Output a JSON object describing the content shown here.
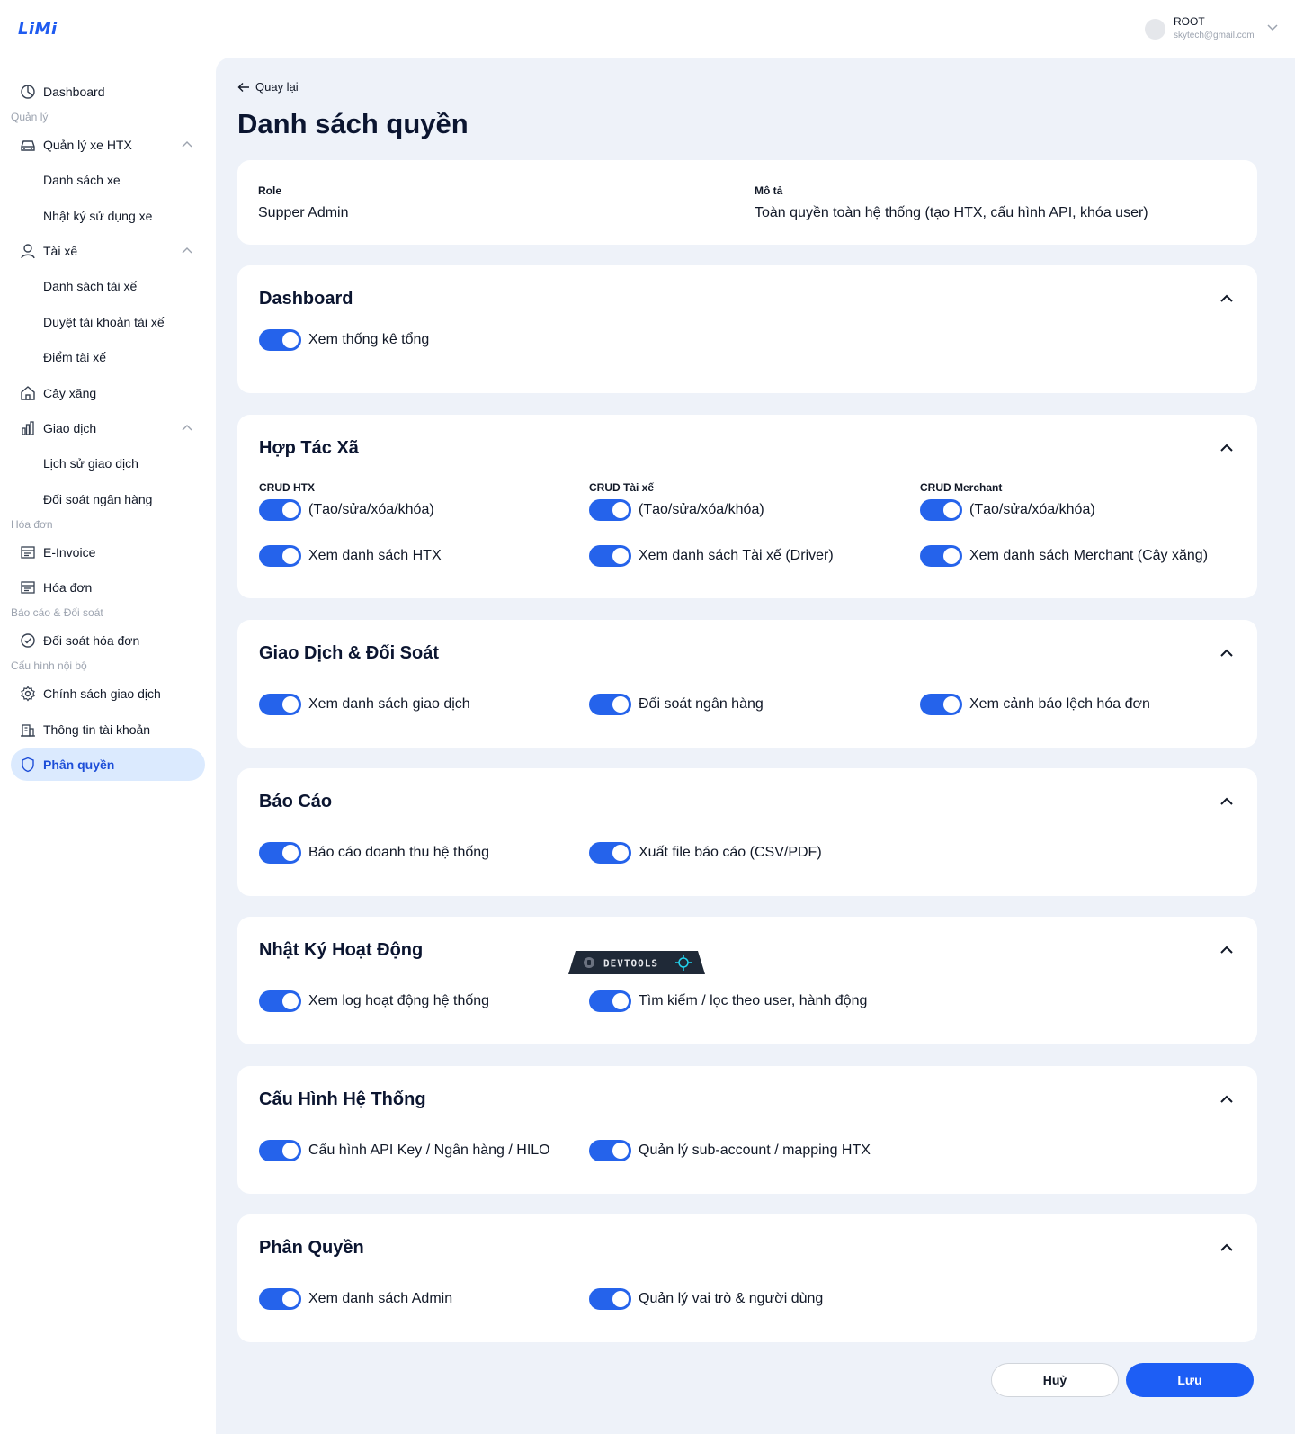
{
  "app": {
    "logo": "LiMi"
  },
  "user": {
    "name": "ROOT",
    "email": "skytech@gmail.com"
  },
  "sidebar": {
    "dashboard": "Dashboard",
    "section_quanly": "Quản lý",
    "xe_htx": "Quản lý xe HTX",
    "danh_sach_xe": "Danh sách xe",
    "nhat_ky_xe": "Nhật ký sử dụng xe",
    "tai_xe": "Tài xế",
    "danh_sach_tai_xe": "Danh sách tài xế",
    "duyet_tai_khoan": "Duyệt tài khoản tài xế",
    "diem_tai_xe": "Điểm tài xế",
    "cay_xang": "Cây xăng",
    "giao_dich": "Giao dịch",
    "lich_su_giao_dich": "Lịch sử giao dịch",
    "doi_soat_ngan_hang": "Đối soát ngân hàng",
    "section_hoadon": "Hóa đơn",
    "e_invoice": "E-Invoice",
    "hoa_don": "Hóa đơn",
    "section_baocao": "Báo cáo & Đối soát",
    "doi_soat_hoa_don": "Đối soát hóa đơn",
    "section_cauhinh": "Cấu hình nội bộ",
    "chinh_sach": "Chính sách giao dịch",
    "thong_tin_tai_khoan": "Thông tin tài khoản",
    "phan_quyen": "Phân quyền"
  },
  "page": {
    "back": "Quay lại",
    "title": "Danh sách quyền",
    "role_label": "Role",
    "role_value": "Supper Admin",
    "desc_label": "Mô tả",
    "desc_value": "Toàn quyền toàn hệ thống (tạo HTX, cấu hình API, khóa user)"
  },
  "sections": {
    "dashboard": {
      "title": "Dashboard",
      "perms": [
        "Xem thống kê tổng"
      ]
    },
    "htx": {
      "title": "Hợp Tác Xã",
      "groups": [
        "CRUD HTX",
        "CRUD Tài xế",
        "CRUD Merchant"
      ],
      "perms": [
        "(Tạo/sửa/xóa/khóa)",
        "(Tạo/sửa/xóa/khóa)",
        "(Tạo/sửa/xóa/khóa)",
        "Xem danh sách HTX",
        "Xem danh sách Tài xế (Driver)",
        "Xem danh sách Merchant (Cây xăng)"
      ]
    },
    "giaodich": {
      "title": "Giao Dịch & Đối Soát",
      "perms": [
        "Xem danh sách giao dịch",
        "Đối soát ngân hàng",
        "Xem cảnh báo lệch hóa đơn"
      ]
    },
    "baocao": {
      "title": "Báo Cáo",
      "perms": [
        "Báo cáo doanh thu hệ thống",
        "Xuất file báo cáo (CSV/PDF)"
      ]
    },
    "nhatky": {
      "title": "Nhật Ký Hoạt Động",
      "perms": [
        "Xem log hoạt động hệ thống",
        "Tìm kiếm / lọc theo user, hành động"
      ]
    },
    "cauhinh": {
      "title": "Cấu Hình Hệ Thống",
      "perms": [
        "Cấu hình API Key / Ngân hàng / HILO",
        "Quản lý sub-account / mapping HTX"
      ]
    },
    "phanquyen": {
      "title": "Phân Quyền",
      "perms": [
        "Xem danh sách Admin",
        "Quản lý vai trò & người dùng"
      ]
    }
  },
  "devtools": {
    "label": "DEVTOOLS"
  },
  "actions": {
    "cancel": "Huỷ",
    "save": "Lưu"
  },
  "colors": {
    "accent": "#2563eb",
    "active_bg": "#dbeafe",
    "page_bg": "#eef2f9"
  }
}
